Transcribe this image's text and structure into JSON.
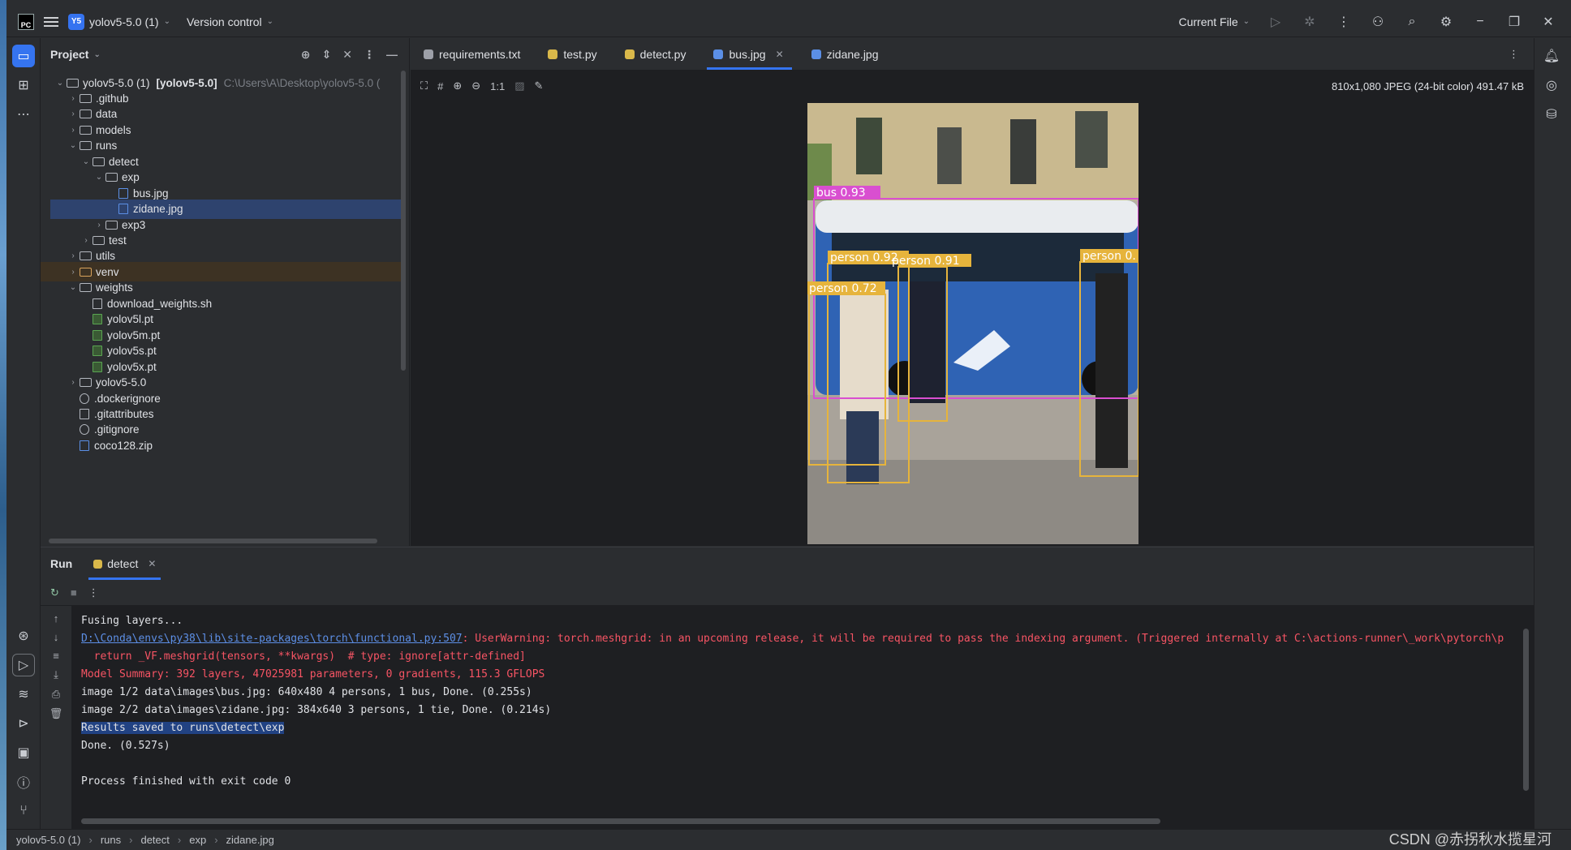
{
  "titlebar": {
    "project_badge": "Y5",
    "project_name": "yolov5-5.0 (1)",
    "vcs_label": "Version control",
    "run_config": "Current File"
  },
  "project_panel": {
    "title": "Project",
    "tree": [
      {
        "label": "yolov5-5.0 (1)",
        "extra": "[yolov5-5.0]",
        "path": "C:\\Users\\A\\Desktop\\yolov5-5.0 (",
        "indent": 0,
        "arrow": "v",
        "kind": "folder"
      },
      {
        "label": ".github",
        "indent": 1,
        "arrow": ">",
        "kind": "folder"
      },
      {
        "label": "data",
        "indent": 1,
        "arrow": ">",
        "kind": "folder"
      },
      {
        "label": "models",
        "indent": 1,
        "arrow": ">",
        "kind": "folder"
      },
      {
        "label": "runs",
        "indent": 1,
        "arrow": "v",
        "kind": "folder"
      },
      {
        "label": "detect",
        "indent": 2,
        "arrow": "v",
        "kind": "folder"
      },
      {
        "label": "exp",
        "indent": 3,
        "arrow": "v",
        "kind": "folder"
      },
      {
        "label": "bus.jpg",
        "indent": 4,
        "arrow": "",
        "kind": "img"
      },
      {
        "label": "zidane.jpg",
        "indent": 4,
        "arrow": "",
        "kind": "img",
        "selected": true
      },
      {
        "label": "exp3",
        "indent": 3,
        "arrow": ">",
        "kind": "folder"
      },
      {
        "label": "test",
        "indent": 2,
        "arrow": ">",
        "kind": "folder"
      },
      {
        "label": "utils",
        "indent": 1,
        "arrow": ">",
        "kind": "folder"
      },
      {
        "label": "venv",
        "indent": 1,
        "arrow": ">",
        "kind": "folder-orange",
        "highlight": true
      },
      {
        "label": "weights",
        "indent": 1,
        "arrow": "v",
        "kind": "folder"
      },
      {
        "label": "download_weights.sh",
        "indent": 2,
        "arrow": "",
        "kind": "file"
      },
      {
        "label": "yolov5l.pt",
        "indent": 2,
        "arrow": "",
        "kind": "pt"
      },
      {
        "label": "yolov5m.pt",
        "indent": 2,
        "arrow": "",
        "kind": "pt"
      },
      {
        "label": "yolov5s.pt",
        "indent": 2,
        "arrow": "",
        "kind": "pt"
      },
      {
        "label": "yolov5x.pt",
        "indent": 2,
        "arrow": "",
        "kind": "pt"
      },
      {
        "label": "yolov5-5.0",
        "indent": 1,
        "arrow": ">",
        "kind": "folder"
      },
      {
        "label": ".dockerignore",
        "indent": 1,
        "arrow": "",
        "kind": "ign"
      },
      {
        "label": ".gitattributes",
        "indent": 1,
        "arrow": "",
        "kind": "file"
      },
      {
        "label": ".gitignore",
        "indent": 1,
        "arrow": "",
        "kind": "ign"
      },
      {
        "label": "coco128.zip",
        "indent": 1,
        "arrow": "",
        "kind": "img"
      }
    ]
  },
  "editor": {
    "tabs": [
      {
        "label": "requirements.txt",
        "color": "#9da0a8"
      },
      {
        "label": "test.py",
        "color": "#d9b84a"
      },
      {
        "label": "detect.py",
        "color": "#d9b84a"
      },
      {
        "label": "bus.jpg",
        "color": "#5b8fe6",
        "active": true
      },
      {
        "label": "zidane.jpg",
        "color": "#5b8fe6"
      }
    ],
    "zoom_label": "1:1",
    "image_info": "810x1,080 JPEG (24-bit color) 491.47 kB",
    "detections": [
      {
        "label": "bus 0.93",
        "color": "#d94fd0"
      },
      {
        "label": "person 0.92",
        "color": "#e6b43c"
      },
      {
        "label": "person 0.91",
        "color": "#e6b43c"
      },
      {
        "label": "person 0.72",
        "color": "#e6b43c"
      },
      {
        "label": "person 0.",
        "color": "#e6b43c"
      }
    ]
  },
  "run_panel": {
    "title": "Run",
    "tab": "detect",
    "lines": [
      {
        "text": "Fusing layers...",
        "style": "norm"
      },
      {
        "link": "D:\\Conda\\envs\\py38\\lib\\site-packages\\torch\\functional.py:507",
        "text": ": UserWarning: torch.meshgrid: in an upcoming release, it will be required to pass the indexing argument. (Triggered internally at C:\\actions-runner\\_work\\pytorch\\p",
        "style": "err"
      },
      {
        "text": "  return _VF.meshgrid(tensors, **kwargs)  # type: ignore[attr-defined]",
        "style": "err"
      },
      {
        "text": "Model Summary: 392 layers, 47025981 parameters, 0 gradients, 115.3 GFLOPS",
        "style": "err"
      },
      {
        "text": "image 1/2 data\\images\\bus.jpg: 640x480 4 persons, 1 bus, Done. (0.255s)",
        "style": "norm"
      },
      {
        "text": "image 2/2 data\\images\\zidane.jpg: 384x640 3 persons, 1 tie, Done. (0.214s)",
        "style": "norm"
      },
      {
        "text": "Results saved to runs\\detect\\exp",
        "style": "sel"
      },
      {
        "text": "Done. (0.527s)",
        "style": "norm"
      },
      {
        "text": "",
        "style": "norm"
      },
      {
        "text": "Process finished with exit code 0",
        "style": "norm"
      }
    ]
  },
  "statusbar": {
    "crumbs": [
      "yolov5-5.0 (1)",
      "runs",
      "detect",
      "exp",
      "zidane.jpg"
    ]
  },
  "watermark": "CSDN @赤拐秋水揽星河"
}
